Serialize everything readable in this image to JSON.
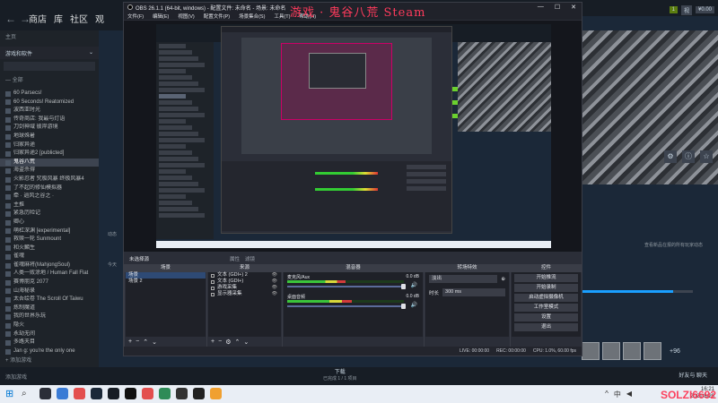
{
  "steam": {
    "nav": {
      "back": "←",
      "forward": "→",
      "store": "商店",
      "library": "库",
      "community": "社区",
      "extra": "观"
    },
    "top_right": {
      "badge": "1",
      "chip": "视",
      "wallet": "¥0.00"
    },
    "sidebar": {
      "home": "主页",
      "filter_label": "游戏和软件",
      "all_label": "— 全部",
      "games": [
        "60 Parsecs!",
        "60 Seconds! Reatomized",
        "波西亚时光",
        "传奇商店: 我最与灯语",
        "刀剑神域 彼岸游境",
        "地球殊暑",
        "归家异途",
        "归家异途2 [publicted]",
        "鬼谷八荒",
        "海盗杀得",
        "火影忍者 究极风暴 终极风暴4",
        "了不起的修仙模拟器",
        "牵 · 逍风之谷之 ·",
        "主推",
        "紧急历险记",
        "卿心",
        "萌杠深渊 [experimental]",
        "救赎一轮 Sunmount",
        "和火麟生",
        "雀魂",
        "雀魂麻将(MahjongSoul)",
        "人类一败涂地 / Human Fall Flat",
        "赛博朋克 2077",
        "山海秘录",
        "太吾绘卷 The Scroll Of Taiwu",
        "炼制魔道",
        "我的世界乐玩",
        "隐火",
        "永劫无间",
        "多路天目",
        "Jan g: you're the only one"
      ],
      "selected_index": 8,
      "add_game": "+ 添加游戏"
    },
    "left_panel": {
      "label1": "动态",
      "label2": "今天"
    },
    "right": {
      "notice": "查看新品在报的所有玩家动态",
      "progress_fraction": 0.82,
      "more_achievements": "+96"
    },
    "bottom": {
      "add_game": "添加游戏",
      "download_title": "下载",
      "download_sub": "已完成 1 / 1 项目",
      "friends": "好友与\n聊天"
    }
  },
  "taskbar": {
    "start_icon": "windows-start-icon",
    "search_icon": "search-icon",
    "app_colors": [
      "#2b2e38",
      "#3a7bd5",
      "#e34f4f",
      "#1b2838",
      "#171d25",
      "#111111",
      "#e34f4f",
      "#2e8b57",
      "#333333",
      "#222222",
      "#f0a030"
    ],
    "tray": [
      "^",
      "中",
      "◀"
    ],
    "time": "16:21",
    "date": "2021/8/20",
    "watermark": "SOLZI6692"
  },
  "obs": {
    "title": "OBS 26.1.1 (64-bit, windows) - 配置文件: 未命名 - 场景: 未命名",
    "watermark": "游戏 · 鬼谷八荒 Steam",
    "window_buttons": [
      "—",
      "☐",
      "✕"
    ],
    "menu": [
      "文件(F)",
      "编辑(E)",
      "视图(V)",
      "配置文件(P)",
      "场景集合(S)",
      "工具(T)",
      "帮助(H)"
    ],
    "scene_info": {
      "label": "未选择源",
      "chip1": "属性",
      "chip2": "滤镜"
    },
    "scenes": {
      "title": "场景",
      "items": [
        "场景",
        "场景 2"
      ],
      "selected": 0
    },
    "sources": {
      "title": "来源",
      "items": [
        "文本 (GDI+) 2",
        "文本 (GDI+)",
        "游戏采集",
        "显示器采集"
      ]
    },
    "mixer": {
      "title": "混音器",
      "channels": [
        {
          "name": "麦克风/Aux",
          "db": "0.0 dB",
          "level": 0.5
        },
        {
          "name": "桌面音频",
          "db": "0.0 dB",
          "level": 0.55
        }
      ]
    },
    "transitions": {
      "title": "转场特效",
      "type": "淡出",
      "duration_label": "时长",
      "duration": "300 ms"
    },
    "controls": {
      "title": "控件",
      "buttons": [
        "开始推流",
        "开始录制",
        "启动虚拟摄像机",
        "工作室模式",
        "设置",
        "退出"
      ]
    },
    "status": {
      "live": "LIVE: 00:00:00",
      "rec": "REC: 00:00:00",
      "cpu": "CPU: 1.0%, 60.00 fps"
    },
    "footer_icons": [
      "+",
      "−",
      "⌃",
      "⌄"
    ]
  },
  "colors": {
    "accent": "#1a9fff",
    "watermark": "#ff2e4d",
    "obs_bg": "#2b2e38",
    "steam_bg": "#1b2838"
  }
}
